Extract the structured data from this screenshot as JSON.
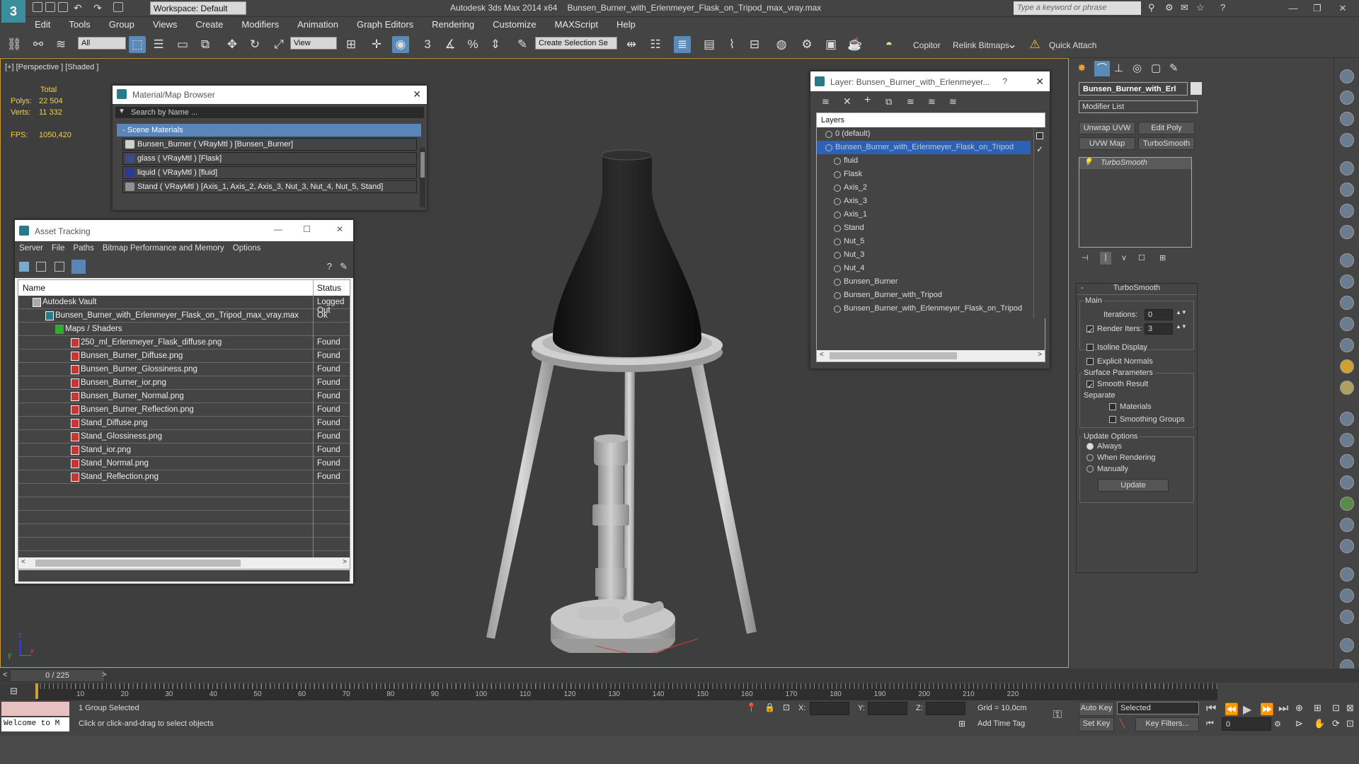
{
  "app": {
    "title": "Autodesk 3ds Max  2014 x64",
    "file": "Bunsen_Burner_with_Erlenmeyer_Flask_on_Tripod_max_vray.max",
    "logo": "3",
    "workspace": "Workspace: Default",
    "search_placeholder": "Type a keyword or phrase"
  },
  "menu": [
    "Edit",
    "Tools",
    "Group",
    "Views",
    "Create",
    "Modifiers",
    "Animation",
    "Graph Editors",
    "Rendering",
    "Customize",
    "MAXScript",
    "Help"
  ],
  "toolbar": {
    "filter": "All",
    "refcoord": "View",
    "selection_set": "Create Selection Se",
    "copitor": "Copitor",
    "relink": "Relink Bitmaps",
    "quick_attach": "Quick Attach",
    "snap_num": "3",
    "angle_num": "%"
  },
  "viewport": {
    "label": "[+] [Perspective ] [Shaded ]",
    "total_label": "Total",
    "polys_label": "Polys:",
    "polys": "22 504",
    "verts_label": "Verts:",
    "verts": "11 332",
    "fps_label": "FPS:",
    "fps": "1050,420",
    "axis_z": "z",
    "axis_x": "x",
    "axis_y": "y"
  },
  "material_browser": {
    "title": "Material/Map Browser",
    "search": "Search by Name ...",
    "group": "Scene Materials",
    "items": [
      {
        "label": "Bunsen_Burner  ( VRayMtl )  [Bunsen_Burner]",
        "color": "#d0d0d0"
      },
      {
        "label": "glass  ( VRayMtl )  [Flask]",
        "color": "#3a4a8a"
      },
      {
        "label": "liquid  ( VRayMtl )  [fluid]",
        "color": "#2a3a9a"
      },
      {
        "label": "Stand  ( VRayMtl )  [Axis_1, Axis_2, Axis_3, Nut_3, Nut_4, Nut_5, Stand]",
        "color": "#909090"
      }
    ]
  },
  "asset_tracking": {
    "title": "Asset Tracking",
    "menu": [
      "Server",
      "File",
      "Paths",
      "Bitmap Performance and Memory",
      "Options"
    ],
    "col_name": "Name",
    "col_status": "Status",
    "rows": [
      {
        "name": "Autodesk Vault",
        "status": "Logged Out",
        "indent": 1
      },
      {
        "name": "Bunsen_Burner_with_Erlenmeyer_Flask_on_Tripod_max_vray.max",
        "status": "Ok",
        "indent": 2
      },
      {
        "name": "Maps / Shaders",
        "status": "",
        "indent": 3
      },
      {
        "name": "250_ml_Erlenmeyer_Flask_diffuse.png",
        "status": "Found",
        "indent": 4
      },
      {
        "name": "Bunsen_Burner_Diffuse.png",
        "status": "Found",
        "indent": 4
      },
      {
        "name": "Bunsen_Burner_Glossiness.png",
        "status": "Found",
        "indent": 4
      },
      {
        "name": "Bunsen_Burner_ior.png",
        "status": "Found",
        "indent": 4
      },
      {
        "name": "Bunsen_Burner_Normal.png",
        "status": "Found",
        "indent": 4
      },
      {
        "name": "Bunsen_Burner_Reflection.png",
        "status": "Found",
        "indent": 4
      },
      {
        "name": "Stand_Diffuse.png",
        "status": "Found",
        "indent": 4
      },
      {
        "name": "Stand_Glossiness.png",
        "status": "Found",
        "indent": 4
      },
      {
        "name": "Stand_ior.png",
        "status": "Found",
        "indent": 4
      },
      {
        "name": "Stand_Normal.png",
        "status": "Found",
        "indent": 4
      },
      {
        "name": "Stand_Reflection.png",
        "status": "Found",
        "indent": 4
      }
    ]
  },
  "layer_explorer": {
    "title": "Layer: Bunsen_Burner_with_Erlenmeyer...",
    "help": "?",
    "header": "Layers",
    "items": [
      {
        "label": "0 (default)",
        "level": 0,
        "selected": false
      },
      {
        "label": "Bunsen_Burner_with_Erlenmeyer_Flask_on_Tripod",
        "level": 0,
        "selected": true
      },
      {
        "label": "fluid",
        "level": 1,
        "selected": false
      },
      {
        "label": "Flask",
        "level": 1,
        "selected": false
      },
      {
        "label": "Axis_2",
        "level": 1,
        "selected": false
      },
      {
        "label": "Axis_3",
        "level": 1,
        "selected": false
      },
      {
        "label": "Axis_1",
        "level": 1,
        "selected": false
      },
      {
        "label": "Stand",
        "level": 1,
        "selected": false
      },
      {
        "label": "Nut_5",
        "level": 1,
        "selected": false
      },
      {
        "label": "Nut_3",
        "level": 1,
        "selected": false
      },
      {
        "label": "Nut_4",
        "level": 1,
        "selected": false
      },
      {
        "label": "Bunsen_Burner",
        "level": 1,
        "selected": false
      },
      {
        "label": "Bunsen_Burner_with_Tripod",
        "level": 1,
        "selected": false
      },
      {
        "label": "Bunsen_Burner_with_Erlenmeyer_Flask_on_Tripod",
        "level": 1,
        "selected": false
      }
    ]
  },
  "command_panel": {
    "object_name": "Bunsen_Burner_with_Erl",
    "modifier_list": "Modifier List",
    "btn_unwrap": "Unwrap UVW",
    "btn_editpoly": "Edit Poly",
    "btn_uvwmap": "UVW Map",
    "btn_turbosmooth": "TurboSmooth",
    "stack_item": "TurboSmooth",
    "rollout": "TurboSmooth",
    "main": "Main",
    "iterations_label": "Iterations:",
    "iterations": "0",
    "render_iters_label": "Render Iters:",
    "render_iters": "3",
    "isoline": "Isoline Display",
    "explicit": "Explicit Normals",
    "surface": "Surface Parameters",
    "smooth": "Smooth Result",
    "separate": "Separate",
    "materials": "Materials",
    "smoothing": "Smoothing Groups",
    "update_options": "Update Options",
    "always": "Always",
    "when_rendering": "When Rendering",
    "manually": "Manually",
    "update": "Update"
  },
  "timeline": {
    "frame": "0 / 225",
    "ticks": [
      "10",
      "20",
      "30",
      "40",
      "50",
      "60",
      "70",
      "80",
      "90",
      "100",
      "110",
      "120",
      "130",
      "140",
      "150",
      "160",
      "170",
      "180",
      "190",
      "200",
      "210",
      "220"
    ]
  },
  "status": {
    "listener": "Welcome to M",
    "selected": "1 Group Selected",
    "prompt": "Click or click-and-drag to select objects",
    "x_label": "X:",
    "y_label": "Y:",
    "z_label": "Z:",
    "grid": "Grid = 10,0cm",
    "add_time_tag": "Add Time Tag",
    "auto_key": "Auto Key",
    "set_key": "Set Key",
    "key_mode": "Selected",
    "key_filters": "Key Filters...",
    "frame_field": "0"
  }
}
